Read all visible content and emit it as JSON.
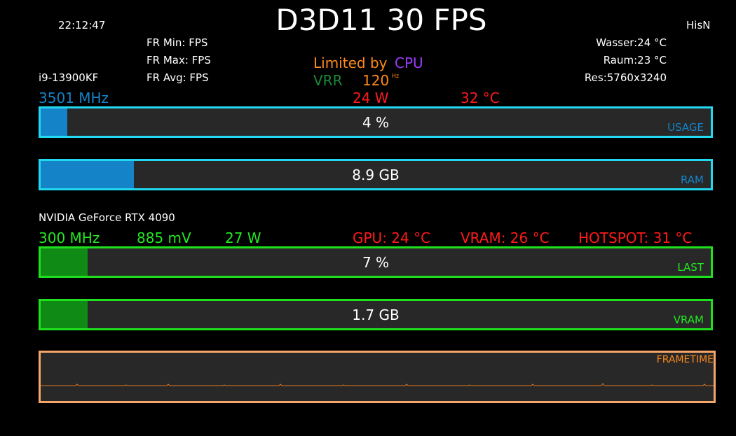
{
  "colors": {
    "cpu_accent": "#1483c8",
    "cyan_border": "#22d8f0",
    "gpu_green_text": "#22e822",
    "gpu_green_fill": "#0f8a14",
    "green_border": "#1fe01f",
    "red_text": "#ff1a1a",
    "orange": "#ff8a1c",
    "purple": "#9b3cff",
    "vrr_green": "#1a8a3a",
    "frametime_border": "#f5a56a"
  },
  "header": {
    "time": "22:12:47",
    "title": "D3D11 30 FPS",
    "user": "HisN",
    "fr_min": "FR Min:  FPS",
    "fr_max": "FR Max:  FPS",
    "fr_avg": "FR Avg:  FPS",
    "limited_by_label": "Limited by",
    "limited_by_value": "CPU",
    "vrr_label": "VRR",
    "refresh_rate": "120",
    "refresh_unit": "Hz",
    "wasser": "Wasser:24 °C",
    "raum": "Raum:23 °C",
    "resolution": "Res:5760x3240"
  },
  "cpu": {
    "name": "i9-13900KF",
    "clock": "3501 MHz",
    "power": "24 W",
    "temp": "32 °C",
    "usage_text": "4 %",
    "usage_percent": 4,
    "usage_tag": "USAGE",
    "ram_text": "8.9 GB",
    "ram_fraction": 0.139,
    "ram_tag": "RAM"
  },
  "gpu": {
    "name": "NVIDIA GeForce RTX 4090",
    "clock": "300 MHz",
    "voltage": "885 mV",
    "power": "27 W",
    "gpu_temp": "GPU: 24 °C",
    "vram_temp": "VRAM: 26 °C",
    "hotspot_temp": "HOTSPOT: 31 °C",
    "load_text": "7 %",
    "load_percent": 7,
    "load_tag": "LAST",
    "vram_text": "1.7 GB",
    "vram_fraction": 0.07,
    "vram_tag": "VRAM"
  },
  "frametime": {
    "tag": "FRAMETIME"
  }
}
